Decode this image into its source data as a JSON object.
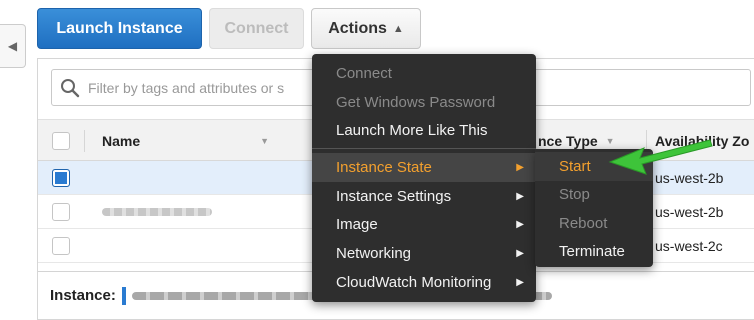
{
  "toolbar": {
    "launch_label": "Launch Instance",
    "connect_label": "Connect",
    "actions_label": "Actions"
  },
  "filter": {
    "placeholder": "Filter by tags and attributes or s"
  },
  "table": {
    "columns": [
      "Name",
      "nce Type",
      "Availability Zo"
    ],
    "rows": [
      {
        "checked": true,
        "zone": "us-west-2b"
      },
      {
        "checked": false,
        "zone": "us-west-2b"
      },
      {
        "checked": false,
        "zone": "us-west-2c"
      }
    ]
  },
  "detail": {
    "label": "Instance:"
  },
  "actions_menu": {
    "items": [
      {
        "label": "Connect",
        "state": "disabled"
      },
      {
        "label": "Get Windows Password",
        "state": "disabled"
      },
      {
        "label": "Launch More Like This",
        "state": "enabled"
      },
      {
        "label": "Instance State",
        "state": "active",
        "has_submenu": true
      },
      {
        "label": "Instance Settings",
        "state": "enabled",
        "has_submenu": true
      },
      {
        "label": "Image",
        "state": "enabled",
        "has_submenu": true
      },
      {
        "label": "Networking",
        "state": "enabled",
        "has_submenu": true
      },
      {
        "label": "CloudWatch Monitoring",
        "state": "enabled",
        "has_submenu": true
      }
    ]
  },
  "instance_state_submenu": {
    "items": [
      {
        "label": "Start",
        "state": "highlighted"
      },
      {
        "label": "Stop",
        "state": "disabled"
      },
      {
        "label": "Reboot",
        "state": "disabled"
      },
      {
        "label": "Terminate",
        "state": "enabled"
      }
    ]
  },
  "colors": {
    "primary_button": "#1f6fc1",
    "menu_background": "#2e2e2e",
    "menu_highlight_text": "#f3a02e",
    "annotation_arrow": "#3ec43a",
    "selected_row": "#e3eefb"
  },
  "icons": {
    "collapse": "chevron-left-icon",
    "search": "search-icon",
    "actions_caret": "chevron-up-icon",
    "submenu_arrow": "triangle-right-icon",
    "sort": "caret-down-icon",
    "annotation": "green-arrow-icon"
  }
}
